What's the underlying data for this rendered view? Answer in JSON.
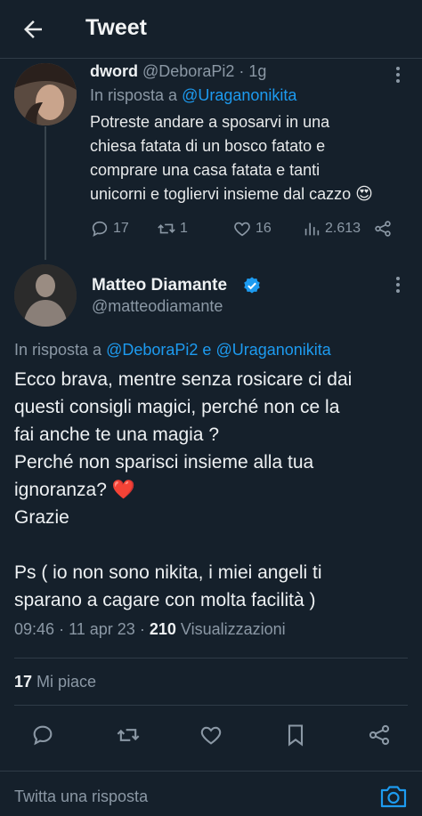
{
  "header": {
    "title": "Tweet"
  },
  "reply_tweet": {
    "name": "dword",
    "handle": "@DeboraPi2",
    "separator": "·",
    "age": "1g",
    "reply_prefix": "In risposta a",
    "reply_to": "@Uraganonikita",
    "lines": [
      "Potreste andare a sposarvi in una",
      "chiesa fatata di un bosco fatato e",
      "comprare una casa fatata e tanti",
      "unicorni e togliervi insieme dal cazzo"
    ],
    "emoji": "😍",
    "replies": "17",
    "retweets": "1",
    "likes": "16",
    "views": "2.613"
  },
  "main_tweet": {
    "name": "Matteo Diamante",
    "handle": "@matteodiamante",
    "reply_prefix": "In risposta a",
    "reply_to_1": "@DeboraPi2",
    "reply_and": "e",
    "reply_to_2": "@Uraganonikita",
    "lines": [
      "Ecco brava, mentre senza rosicare ci dai",
      "questi consigli magici, perché non ce la",
      "fai anche te una magia ?",
      "Perché non sparisci insieme alla tua",
      "ignoranza?",
      "Grazie",
      "",
      "Ps ( io non sono nikita, i miei angeli ti",
      "sparano a cagare con molta facilità )"
    ],
    "heart_emoji": "❤️",
    "time": "09:46",
    "dot": "·",
    "date": "11 apr 23",
    "views_count": "210",
    "views_label": "Visualizzazioni",
    "likes_count": "17",
    "likes_label": "Mi piace"
  },
  "reply_bar": {
    "placeholder": "Twitta una risposta"
  },
  "colors": {
    "background": "#15202b",
    "accent": "#1d9bf0",
    "muted": "#8b98a5"
  }
}
